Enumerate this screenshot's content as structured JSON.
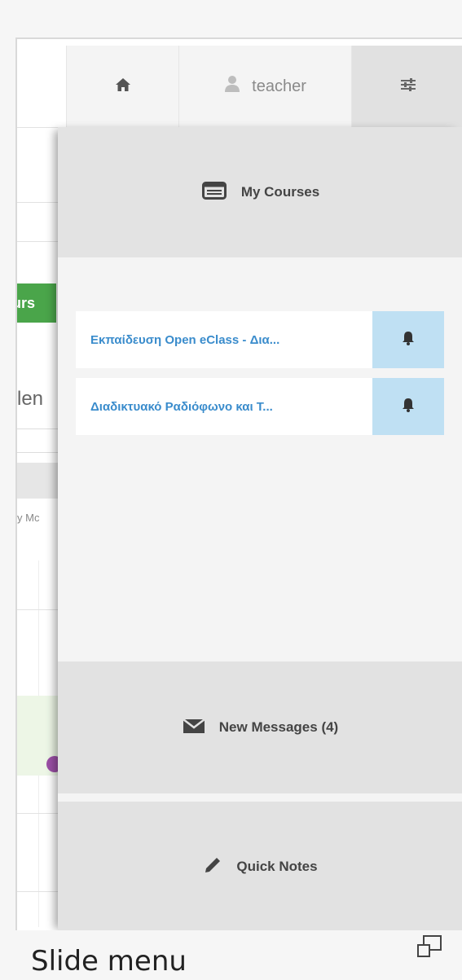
{
  "topbar": {
    "home_icon": "home-icon",
    "user_icon": "user-icon",
    "username": "teacher",
    "settings_icon": "sliders-icon"
  },
  "underlying_page": {
    "button_fragment": "urs",
    "heading_fragment": "len",
    "small_fragment": "y Mc"
  },
  "panel": {
    "header": {
      "icon": "list-window-icon",
      "label": "My Courses"
    },
    "courses": [
      {
        "name": "Εκπαίδευση Open eClass - Δια...",
        "bell_icon": "bell-icon"
      },
      {
        "name": "Διαδικτυακό Ραδιόφωνο και Τ...",
        "bell_icon": "bell-icon"
      }
    ],
    "messages": {
      "icon": "envelope-icon",
      "label": "New Messages (4)"
    },
    "notes": {
      "icon": "pencil-icon",
      "label": "Quick Notes"
    }
  },
  "caption": {
    "text": "Slide menu",
    "expand_icon": "expand-icon"
  },
  "colors": {
    "accent_link": "#3a8ccc",
    "bell_bg": "#bfe0f3",
    "section_bg": "#e2e2e2",
    "green_button": "#4aa54a"
  }
}
